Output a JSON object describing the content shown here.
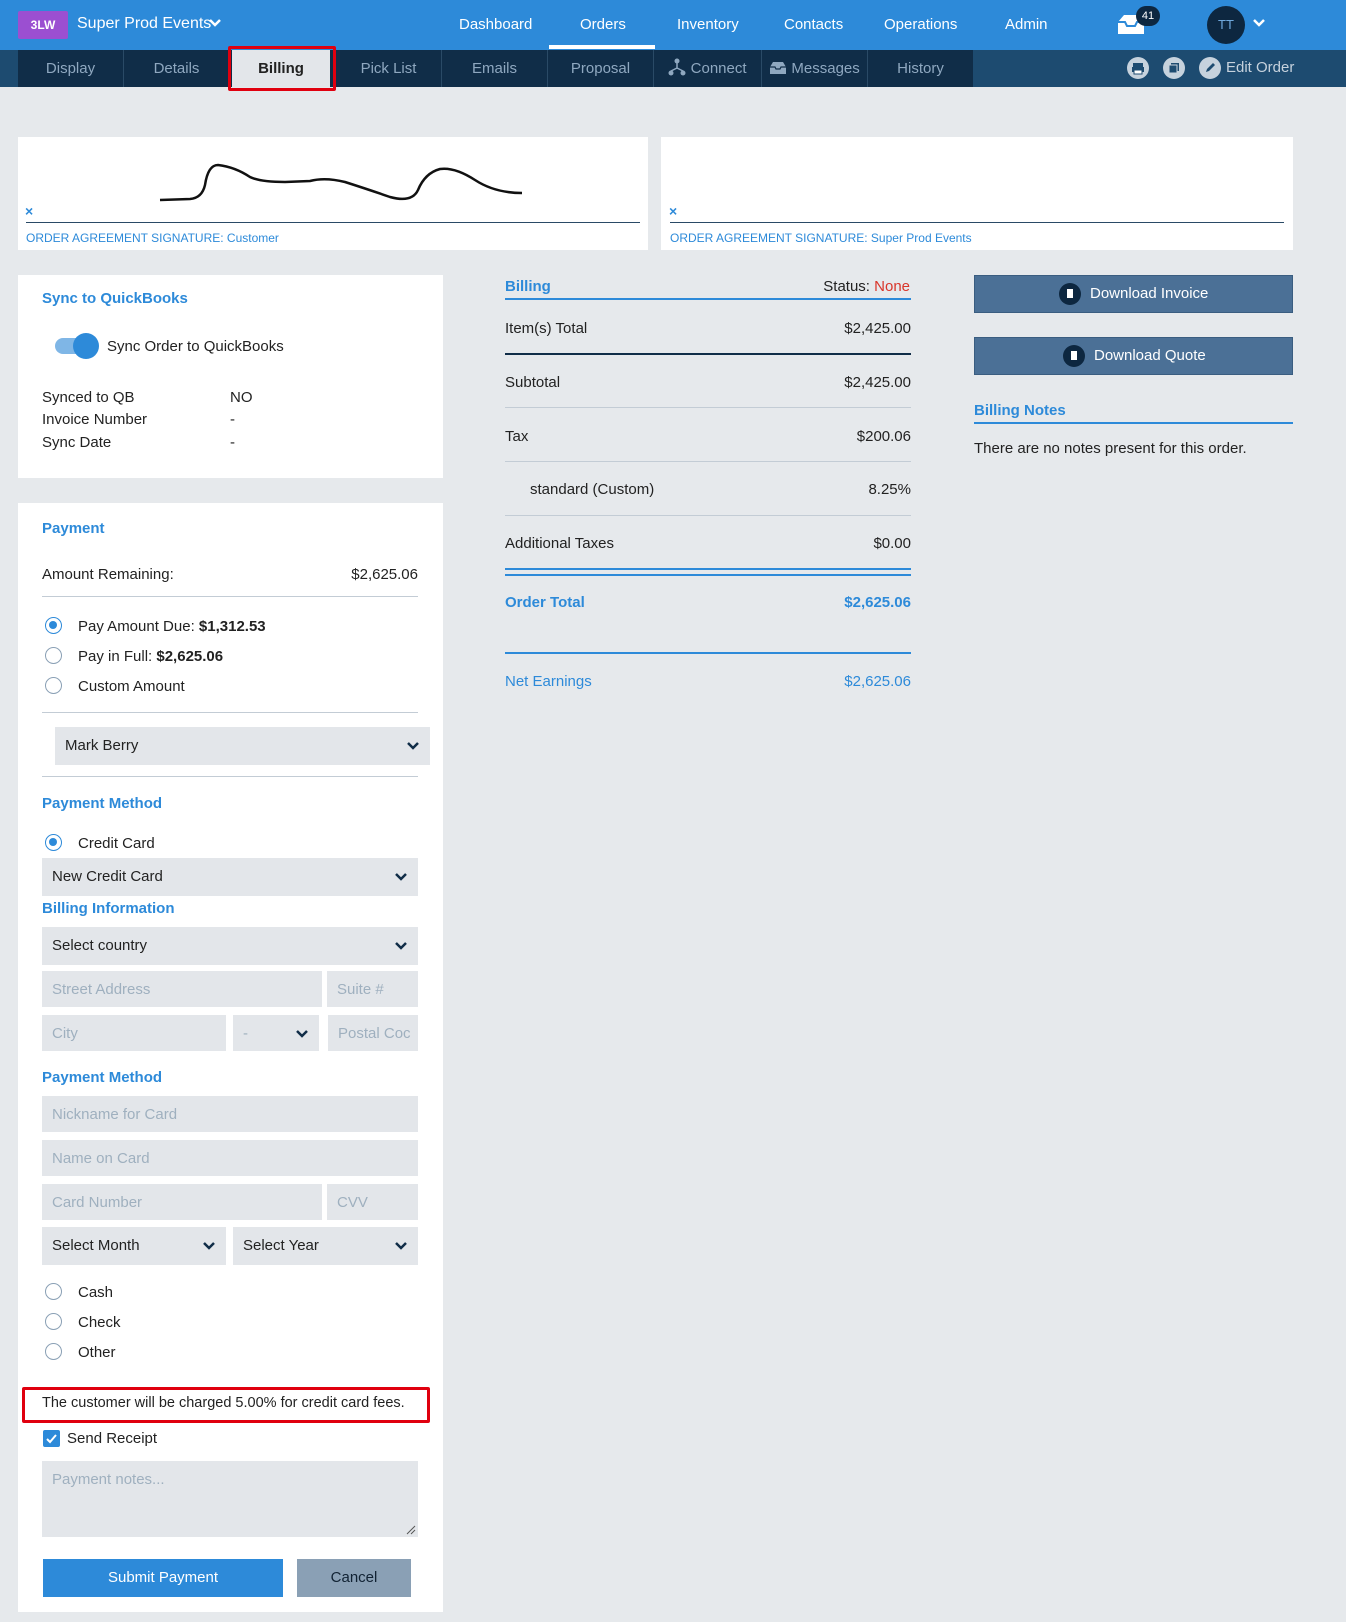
{
  "topnav": {
    "logo": "3LW",
    "company": "Super Prod Events",
    "links": [
      "Dashboard",
      "Orders",
      "Inventory",
      "Contacts",
      "Operations",
      "Admin"
    ],
    "inbox_count": "41",
    "avatar": "TT"
  },
  "subnav": {
    "tabs": [
      "Display",
      "Details",
      "Billing",
      "Pick List",
      "Emails",
      "Proposal",
      "Connect",
      "Messages",
      "History"
    ],
    "edit_order": "Edit Order"
  },
  "signatures": {
    "customer_label": "ORDER AGREEMENT SIGNATURE: Customer",
    "company_label": "ORDER AGREEMENT SIGNATURE: Super Prod Events",
    "clear": "×"
  },
  "quickbooks": {
    "title": "Sync to QuickBooks",
    "toggle_label": "Sync Order to QuickBooks",
    "rows": [
      {
        "label": "Synced to QB",
        "value": "NO"
      },
      {
        "label": "Invoice Number",
        "value": "-"
      },
      {
        "label": "Sync Date",
        "value": "-"
      }
    ]
  },
  "payment": {
    "title": "Payment",
    "amount_remaining_label": "Amount Remaining:",
    "amount_remaining_value": "$2,625.06",
    "options": [
      {
        "label": "Pay Amount Due:",
        "amount": "$1,312.53",
        "selected": true
      },
      {
        "label": "Pay in Full:",
        "amount": "$2,625.06",
        "selected": false
      },
      {
        "label": "Custom Amount",
        "amount": "",
        "selected": false
      }
    ],
    "payer": "Mark Berry",
    "method_title": "Payment Method",
    "method_credit": "Credit Card",
    "card_select": "New Credit Card",
    "billing_info_title": "Billing Information",
    "country_select": "Select country",
    "street_ph": "Street Address",
    "suite_ph": "Suite #",
    "city_ph": "City",
    "state_ph": "-",
    "postal_ph": "Postal Coc",
    "method_title_2": "Payment Method",
    "nickname_ph": "Nickname for Card",
    "name_ph": "Name on Card",
    "card_ph": "Card Number",
    "cvv_ph": "CVV",
    "month_select": "Select Month",
    "year_select": "Select Year",
    "other_methods": [
      "Cash",
      "Check",
      "Other"
    ],
    "fee_notice": "The customer will be charged 5.00% for credit card fees.",
    "send_receipt": "Send Receipt",
    "notes_ph": "Payment notes...",
    "submit": "Submit Payment",
    "cancel": "Cancel"
  },
  "billing": {
    "title": "Billing",
    "status_label": "Status:",
    "status_value": "None",
    "rows": [
      {
        "label": "Item(s) Total",
        "value": "$2,425.00"
      },
      {
        "label": "Subtotal",
        "value": "$2,425.00"
      },
      {
        "label": "Tax",
        "value": "$200.06"
      },
      {
        "label": "standard (Custom)",
        "value": "8.25%"
      },
      {
        "label": "Additional Taxes",
        "value": "$0.00"
      }
    ],
    "order_total_label": "Order Total",
    "order_total_value": "$2,625.06",
    "net_label": "Net Earnings",
    "net_value": "$2,625.06"
  },
  "actions": {
    "download_invoice": "Download Invoice",
    "download_quote": "Download Quote",
    "notes_title": "Billing Notes",
    "notes_text": "There are no notes present for this order."
  },
  "colors": {
    "accent": "#2d8ad9",
    "status_none": "#d9362b",
    "highlight": "#e0000f"
  }
}
